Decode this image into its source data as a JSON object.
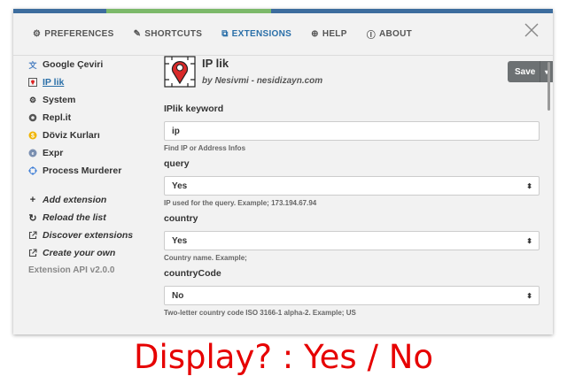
{
  "tabs": [
    {
      "label": "Preferences",
      "icon": "gear-icon",
      "glyph": "⚙"
    },
    {
      "label": "Shortcuts",
      "icon": "edit-icon",
      "glyph": "✎"
    },
    {
      "label": "Extensions",
      "icon": "cubes-icon",
      "glyph": "⧉"
    },
    {
      "label": "Help",
      "icon": "lifebuoy-icon",
      "glyph": "⊕"
    },
    {
      "label": "About",
      "icon": "info-icon",
      "glyph": "ⓘ"
    }
  ],
  "sidebar": {
    "extensions": [
      {
        "label": "Google Çeviri",
        "icon": "translate-icon"
      },
      {
        "label": "IP lik",
        "icon": "map-pin-icon"
      },
      {
        "label": "System",
        "icon": "gear-icon"
      },
      {
        "label": "Repl.it",
        "icon": "replit-icon"
      },
      {
        "label": "Döviz Kurları",
        "icon": "currency-icon"
      },
      {
        "label": "Expr",
        "icon": "expr-icon"
      },
      {
        "label": "Process Murderer",
        "icon": "crosshair-icon"
      }
    ],
    "actions": [
      {
        "label": "Add extension",
        "icon": "plus-icon"
      },
      {
        "label": "Reload the list",
        "icon": "refresh-icon"
      },
      {
        "label": "Discover extensions",
        "icon": "external-link-icon"
      },
      {
        "label": "Create your own",
        "icon": "external-link-icon"
      }
    ],
    "api_version": "Extension API v2.0.0"
  },
  "extension": {
    "name": "IP lik",
    "author": "by Nesivmi - nesidizayn.com",
    "save_label": "Save"
  },
  "fields": {
    "keyword": {
      "label": "IPlik keyword",
      "value": "ip",
      "help": "Find IP or Address Infos"
    },
    "query": {
      "label": "query",
      "value": "Yes",
      "help": "IP used for the query. Example; 173.194.67.94"
    },
    "country": {
      "label": "country",
      "value": "Yes",
      "help": "Country name. Example;"
    },
    "countryCode": {
      "label": "countryCode",
      "value": "No",
      "help": "Two-letter country code ISO 3166-1 alpha-2. Example; US"
    }
  },
  "caption": "Display? : Yes / No",
  "colors": {
    "accent": "#2a6fa8",
    "caption": "#e60000",
    "save": "#6d7173",
    "topbar": [
      "#3d6d9e",
      "#7cb96a",
      "#3d6d9e"
    ]
  }
}
